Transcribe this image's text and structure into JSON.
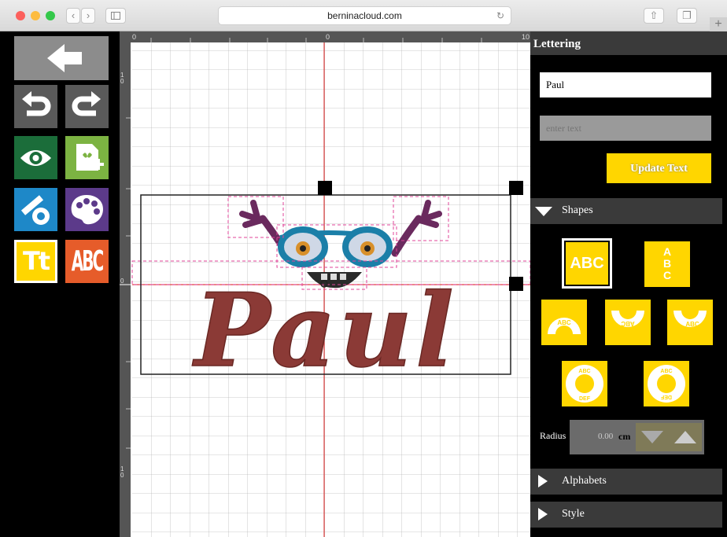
{
  "browser": {
    "url": "berninacloud.com"
  },
  "canvas": {
    "ruler_top": [
      "0",
      "0",
      "10"
    ],
    "ruler_left": [
      "1\n0",
      "0",
      "1\n0"
    ],
    "design_text": "Paul"
  },
  "toolbar": {
    "back_icon": "arrow-left-icon",
    "undo_icon": "undo-icon",
    "redo_icon": "redo-icon",
    "preview_icon": "eye-icon",
    "add_design_icon": "add-design-icon",
    "edit_tools_icon": "edit-settings-icon",
    "colors_icon": "palette-icon",
    "lettering_label": "Tt",
    "monogram_label": "ABC"
  },
  "panel": {
    "title": "Lettering",
    "text_value": "Paul",
    "text_placeholder": "enter text",
    "update_button": "Update Text",
    "shapes_label": "Shapes",
    "shape_straight": "ABC",
    "shape_vertical": [
      "A",
      "B",
      "C"
    ],
    "shape_arc": "ABC",
    "shape_circle_top": "ABC",
    "shape_circle_bottom": "DEF",
    "radius_label": "Radius",
    "radius_value": "0.00",
    "radius_unit": "cm",
    "alphabets_label": "Alphabets",
    "style_label": "Style"
  },
  "colors": {
    "accent_yellow": "#ffd600",
    "embroidery_red": "#8b3a36",
    "glasses_blue": "#1b7fa8",
    "antenna_purple": "#6a2a5e"
  }
}
